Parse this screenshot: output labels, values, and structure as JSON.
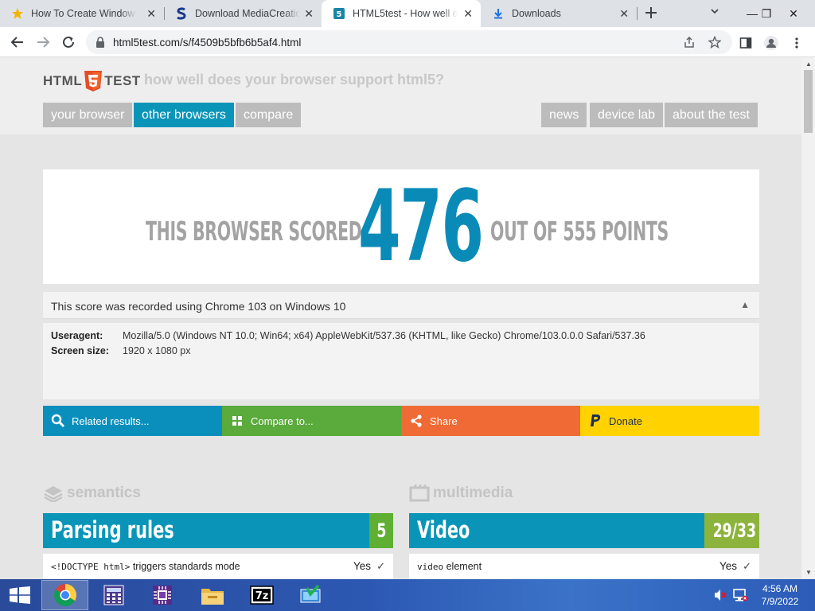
{
  "tabs": [
    {
      "title": "How To Create Windows",
      "icon": "star-favicon-icon",
      "close": "✕"
    },
    {
      "title": "Download MediaCreation",
      "icon": "s-favicon-icon",
      "close": "✕"
    },
    {
      "title": "HTML5test - How well d",
      "icon": "html5-favicon-icon",
      "close": "✕"
    },
    {
      "title": "Downloads",
      "icon": "download-favicon-icon",
      "close": "✕"
    }
  ],
  "window_controls": {
    "minimize": "—",
    "maximize": "❐",
    "close": "✕"
  },
  "address_bar": {
    "url": "html5test.com/s/f4509b5bfb6b5af4.html"
  },
  "site": {
    "logo_left": "HTML",
    "logo_right": "TEST",
    "tagline": "how well does your browser support html5?",
    "nav_left": [
      "your browser",
      "other browsers",
      "compare"
    ],
    "nav_right": [
      "news",
      "device lab",
      "about the test"
    ],
    "selected_nav": "other browsers",
    "accent_color": "#0a95b8"
  },
  "score": {
    "prefix": "THIS BROWSER SCORED",
    "value": "476",
    "suffix": "OUT OF 555 POINTS"
  },
  "recorded": {
    "text": "This score was recorded using Chrome 103 on Windows 10",
    "toggle": "▲"
  },
  "details": {
    "useragent_label": "Useragent:",
    "useragent": "Mozilla/5.0 (Windows NT 10.0; Win64; x64) AppleWebKit/537.36 (KHTML, like Gecko) Chrome/103.0.0.0 Safari/537.36",
    "screen_label": "Screen size:",
    "screen_size": "1920 x 1080 px"
  },
  "actions": [
    {
      "label": "Related results...",
      "icon": "search-icon",
      "color": "#0a8fbd"
    },
    {
      "label": "Compare to...",
      "icon": "grid-icon",
      "color": "#5aaa3c"
    },
    {
      "label": "Share",
      "icon": "share-icon",
      "color": "#ef6a35"
    },
    {
      "label": "Donate",
      "icon": "paypal-icon",
      "color": "#ffd200"
    }
  ],
  "sections": [
    {
      "heading": "semantics",
      "icon": "stack-icon",
      "card_title": "Parsing rules",
      "card_score": "5",
      "row_code": "<!DOCTYPE html>",
      "row_text": " triggers standards mode",
      "row_result": "Yes",
      "row_check": "✓"
    },
    {
      "heading": "multimedia",
      "icon": "film-icon",
      "card_title": "Video",
      "card_score": "29/33",
      "row_code": "video",
      "row_text": " element",
      "row_result": "Yes",
      "row_check": "✓"
    }
  ],
  "taskbar": {
    "apps": [
      "chrome-icon",
      "calculator-icon",
      "chip-icon",
      "file-explorer-icon",
      "7zip-icon",
      "media-creation-tool-icon"
    ],
    "time": "4:56 AM",
    "date": "7/9/2022"
  }
}
